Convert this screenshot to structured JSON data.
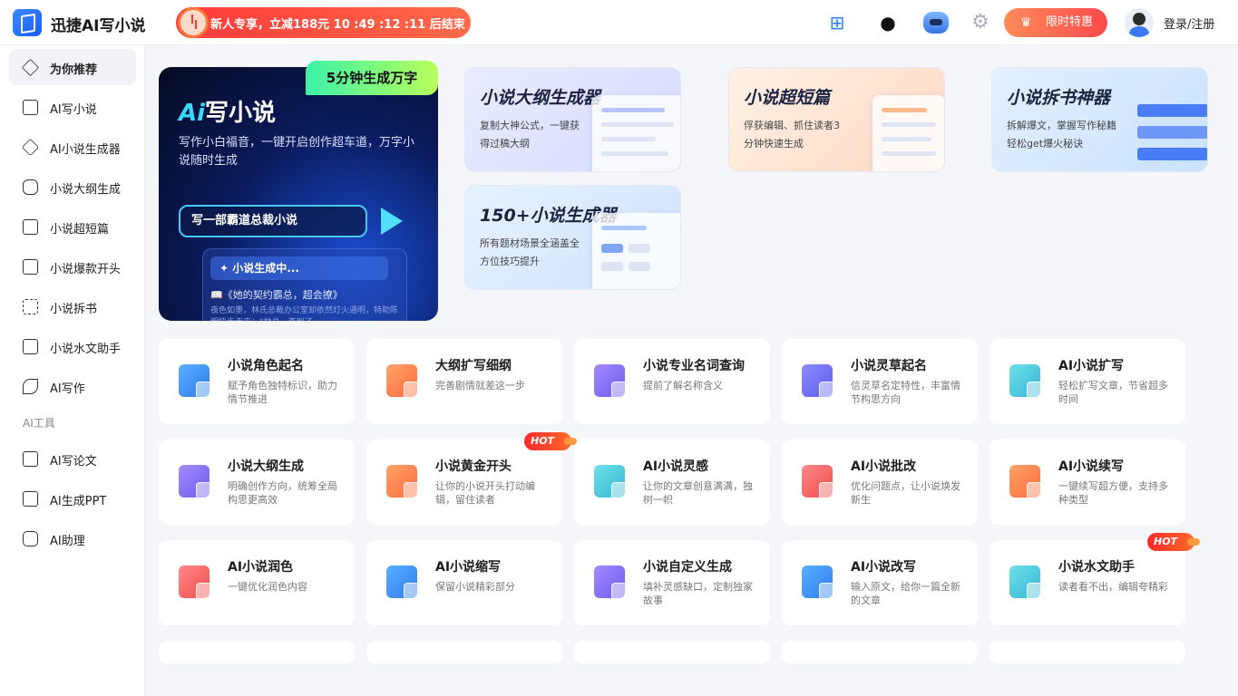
{
  "header": {
    "app_title": "迅捷AI写小说",
    "promo_text": "新人专享，立减188元 10 :49 :12 :11 后结束",
    "offer_label": "限时特惠",
    "login_label": "登录/注册"
  },
  "sidebar": {
    "items": [
      {
        "label": "为你推荐",
        "active": true
      },
      {
        "label": "AI写小说"
      },
      {
        "label": "AI小说生成器"
      },
      {
        "label": "小说大纲生成"
      },
      {
        "label": "小说超短篇"
      },
      {
        "label": "小说爆款开头"
      },
      {
        "label": "小说拆书"
      },
      {
        "label": "小说水文助手"
      },
      {
        "label": "AI写作"
      }
    ],
    "section_label": "AI工具",
    "tool_items": [
      {
        "label": "AI写论文"
      },
      {
        "label": "AI生成PPT"
      },
      {
        "label": "AI助理"
      }
    ]
  },
  "hero": {
    "badge": "5分钟生成万字",
    "title_ai": "Ai",
    "title_rest": "写小说",
    "desc": "写作小白福音，一键开启创作超车道，万字小说随时生成",
    "input_value": "写一部霸道总裁小说",
    "generating": "✦ 小说生成中...",
    "book_title": "📖《她的契约霸总，超会撩》",
    "story": "夜色如墨，林氏总裁办公室却依然灯火通明，特助陈明快步走来：“林总，查到了"
  },
  "features": [
    {
      "title": "小说大纲生成器",
      "desc": "复制大神公式，一键获得过稿大纲"
    },
    {
      "title": "小说超短篇",
      "desc": "俘获编辑、抓住读者3分钟快速生成"
    },
    {
      "title": "小说拆书神器",
      "desc": "拆解爆文，掌握写作秘籍轻松get爆火秘诀"
    },
    {
      "title": "150+小说生成器",
      "desc": "所有题材场景全涵盖全方位技巧提升"
    }
  ],
  "tools": [
    {
      "title": "小说角色起名",
      "desc": "赋予角色独特标识，助力情节推进"
    },
    {
      "title": "大纲扩写细纲",
      "desc": "完善剧情就差这一步"
    },
    {
      "title": "小说专业名词查询",
      "desc": "提前了解名称含义"
    },
    {
      "title": "小说灵草起名",
      "desc": "信灵草名定特性，丰富情节构思方向"
    },
    {
      "title": "AI小说扩写",
      "desc": "轻松扩写文章，节省超多时间"
    },
    {
      "title": "小说大纲生成",
      "desc": "明确创作方向，统筹全局构思更高效"
    },
    {
      "title": "小说黄金开头",
      "desc": "让你的小说开头打动编辑，留住读者"
    },
    {
      "title": "AI小说灵感",
      "desc": "让你的文章创意满满，独树一帜"
    },
    {
      "title": "AI小说批改",
      "desc": "优化问题点，让小说焕发新生"
    },
    {
      "title": "AI小说续写",
      "desc": "一键续写超方便，支持多种类型"
    },
    {
      "title": "AI小说润色",
      "desc": "一键优化润色内容"
    },
    {
      "title": "AI小说缩写",
      "desc": "保留小说精彩部分"
    },
    {
      "title": "小说自定义生成",
      "desc": "填补灵感缺口，定制独家故事"
    },
    {
      "title": "AI小说改写",
      "desc": "输入原文，给你一篇全新的文章"
    },
    {
      "title": "小说水文助手",
      "desc": "读者看不出，编辑夸精彩"
    }
  ],
  "hot_label": "HOT",
  "colors": {
    "primary": "#2c6cf6",
    "hot": "#ff3a2a",
    "promo": "#ff4b4b"
  }
}
